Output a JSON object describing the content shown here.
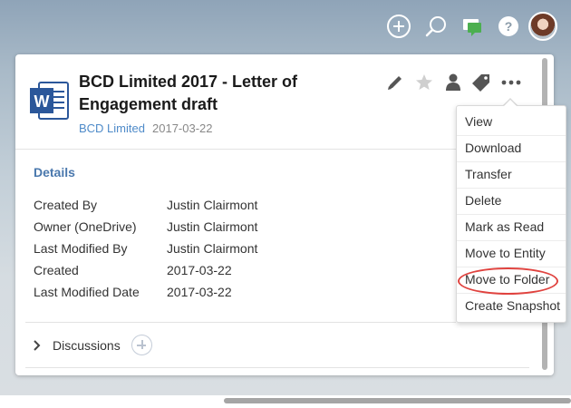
{
  "document": {
    "title": "BCD Limited 2017 - Letter of Engagement draft",
    "entity_link": "BCD Limited",
    "date": "2017-03-22",
    "file_badge": "W"
  },
  "details": {
    "heading": "Details",
    "rows": [
      {
        "label": "Created By",
        "value": "Justin Clairmont"
      },
      {
        "label": "Owner (OneDrive)",
        "value": "Justin Clairmont"
      },
      {
        "label": "Last Modified By",
        "value": "Justin Clairmont"
      },
      {
        "label": "Created",
        "value": "2017-03-22"
      },
      {
        "label": "Last Modified Date",
        "value": "2017-03-22"
      }
    ]
  },
  "discussions": {
    "label": "Discussions"
  },
  "menu": {
    "items": [
      {
        "label": "View"
      },
      {
        "label": "Download"
      },
      {
        "label": "Transfer"
      },
      {
        "label": "Delete"
      },
      {
        "label": "Mark as Read"
      },
      {
        "label": "Move to Entity"
      },
      {
        "label": "Move to Folder",
        "highlighted": true
      },
      {
        "label": "Create Snapshot"
      }
    ]
  },
  "icons": {
    "topbar": [
      "add-icon",
      "search-icon",
      "chat-icon",
      "help-icon",
      "avatar"
    ],
    "actions": [
      "edit-pencil-icon",
      "star-icon",
      "person-icon",
      "tag-icon",
      "more-icon"
    ]
  },
  "colors": {
    "link": "#4f8bc9",
    "section_heading": "#4a78ad",
    "word_blue": "#2b579a",
    "chat_green": "#4caf50",
    "highlight_red": "#e0433f"
  }
}
